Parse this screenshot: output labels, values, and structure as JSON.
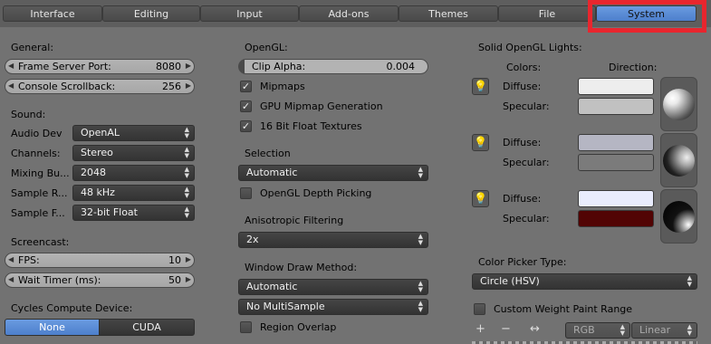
{
  "tabs": [
    {
      "label": "Interface"
    },
    {
      "label": "Editing"
    },
    {
      "label": "Input"
    },
    {
      "label": "Add-ons"
    },
    {
      "label": "Themes"
    },
    {
      "label": "File"
    },
    {
      "label": "System"
    }
  ],
  "general": {
    "heading": "General:",
    "frame_server_port": {
      "label": "Frame Server Port:",
      "value": "8080"
    },
    "console_scrollback": {
      "label": "Console Scrollback:",
      "value": "256"
    }
  },
  "sound": {
    "heading": "Sound:",
    "audio_dev": {
      "label": "Audio Dev",
      "value": "OpenAL"
    },
    "channels": {
      "label": "Channels:",
      "value": "Stereo"
    },
    "mixing_buffer": {
      "label": "Mixing Bu...",
      "value": "2048"
    },
    "sample_rate": {
      "label": "Sample R...",
      "value": "48 kHz"
    },
    "sample_format": {
      "label": "Sample F...",
      "value": "32-bit Float"
    }
  },
  "screencast": {
    "heading": "Screencast:",
    "fps": {
      "label": "FPS:",
      "value": "10"
    },
    "wait_timer": {
      "label": "Wait Timer (ms):",
      "value": "50"
    }
  },
  "cycles": {
    "heading": "Cycles Compute Device:",
    "none_label": "None",
    "cuda_label": "CUDA"
  },
  "opengl": {
    "heading": "OpenGL:",
    "clip_alpha": {
      "label": "Clip Alpha:",
      "value": "0.004"
    },
    "mipmaps": "Mipmaps",
    "gpu_mipmap": "GPU Mipmap Generation",
    "float_textures": "16 Bit Float Textures"
  },
  "selection": {
    "heading": "Selection",
    "value": "Automatic",
    "depth_picking": "OpenGL Depth Picking"
  },
  "anisotropic": {
    "heading": "Anisotropic Filtering",
    "value": "2x"
  },
  "window_draw": {
    "heading": "Window Draw Method:",
    "value": "Automatic",
    "multisample": "No MultiSample",
    "region_overlap": "Region Overlap"
  },
  "lights": {
    "heading": "Solid OpenGL Lights:",
    "colors_header": "Colors:",
    "direction_header": "Direction:",
    "diffuse_label": "Diffuse:",
    "specular_label": "Specular:",
    "items": [
      {
        "diffuse_color": "#ededed",
        "specular_color": "#c1c1c1"
      },
      {
        "diffuse_color": "#b5b6c3",
        "specular_color": "#7b7b7b"
      },
      {
        "diffuse_color": "#e9ecfd",
        "specular_color": "#520404"
      }
    ]
  },
  "color_picker": {
    "heading": "Color Picker Type:",
    "value": "Circle (HSV)",
    "custom_weight": "Custom Weight Paint Range",
    "rgb_label": "RGB",
    "linear_label": "Linear"
  }
}
